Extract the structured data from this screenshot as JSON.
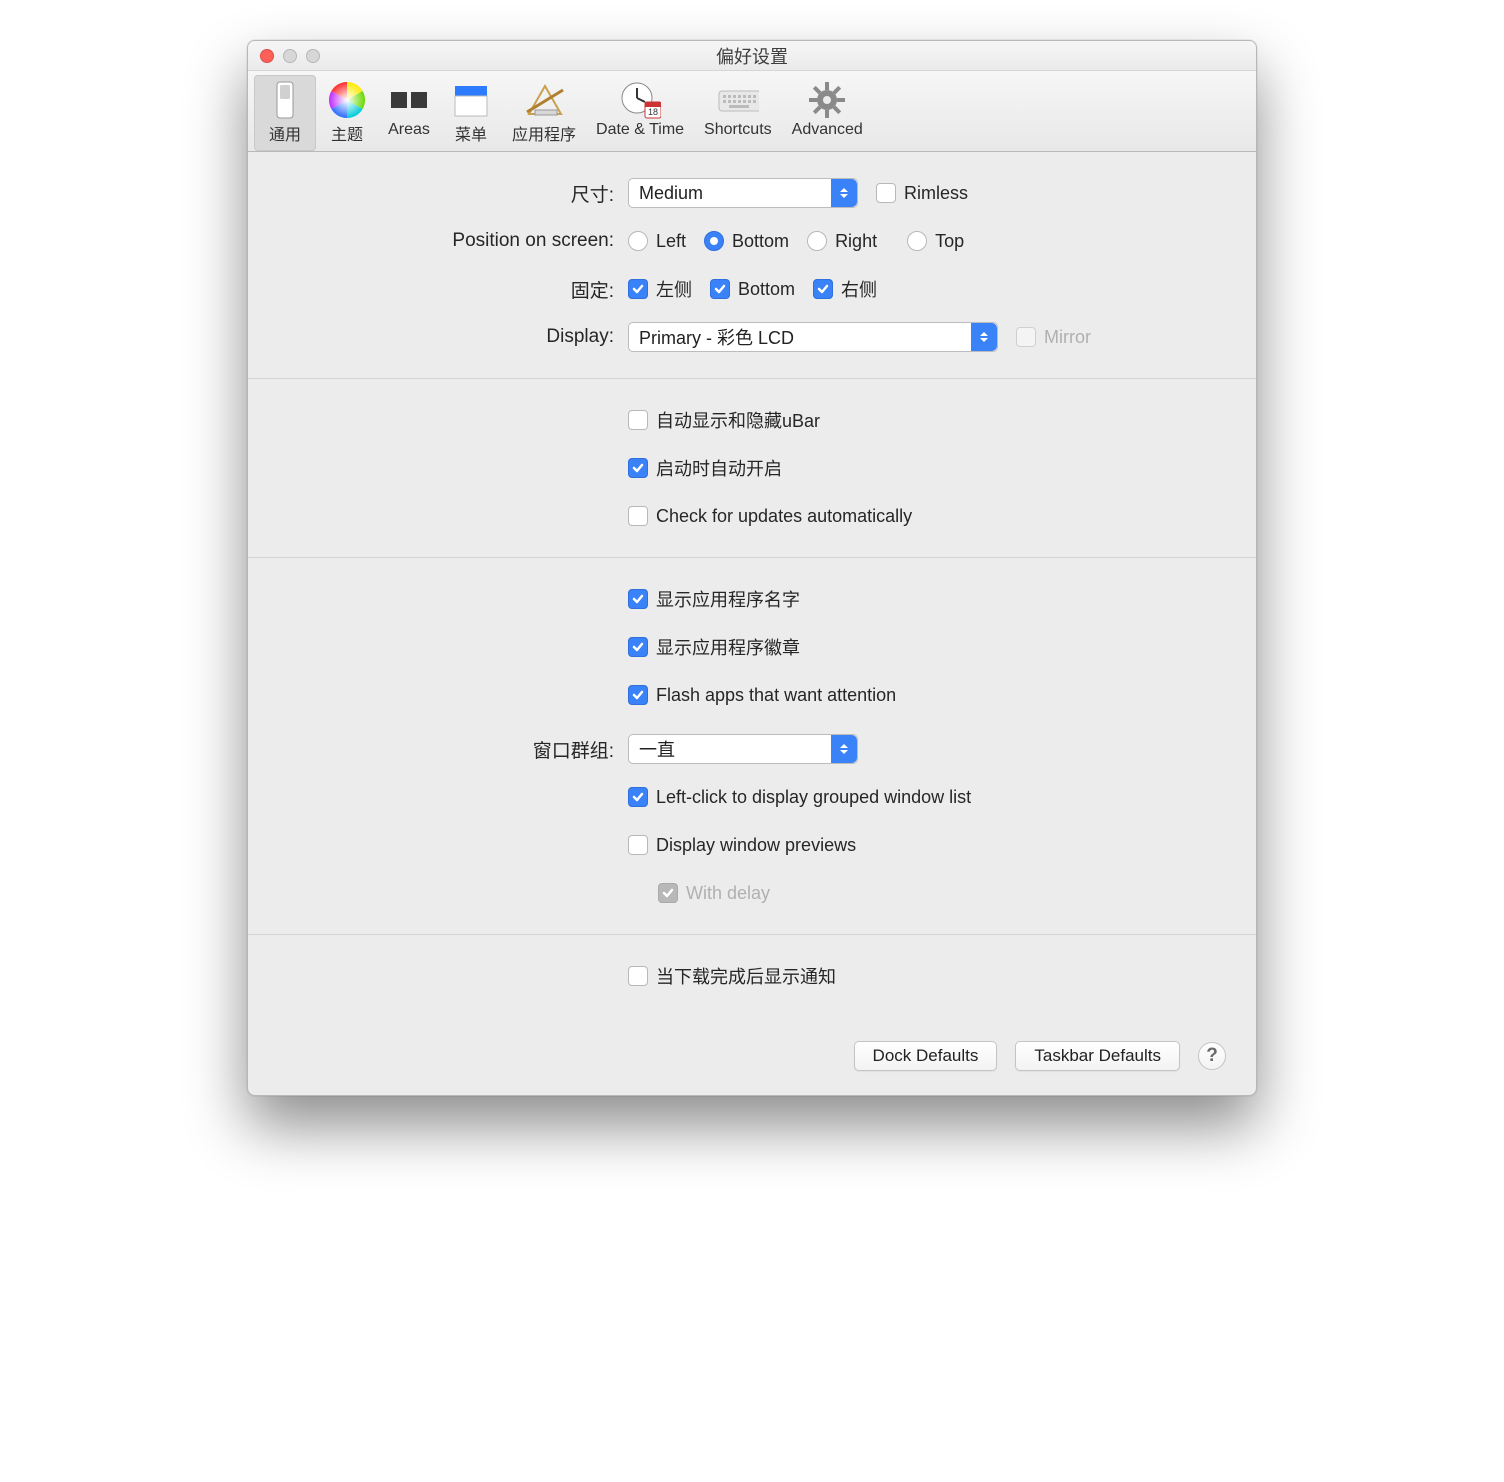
{
  "window": {
    "title": "偏好设置"
  },
  "toolbar": [
    {
      "label": "通用",
      "icon": "switch",
      "selected": true
    },
    {
      "label": "主题",
      "icon": "colorwheel"
    },
    {
      "label": "Areas",
      "icon": "areas"
    },
    {
      "label": "菜单",
      "icon": "menu"
    },
    {
      "label": "应用程序",
      "icon": "apps"
    },
    {
      "label": "Date & Time",
      "icon": "clock"
    },
    {
      "label": "Shortcuts",
      "icon": "keyboard"
    },
    {
      "label": "Advanced",
      "icon": "gear"
    }
  ],
  "labels": {
    "size": "尺寸:",
    "position": "Position on screen:",
    "pinning": "固定:",
    "display": "Display:",
    "window_groups": "窗口群组:"
  },
  "size": {
    "value": "Medium",
    "rimless": "Rimless",
    "rimless_checked": false
  },
  "position": {
    "options": {
      "left": "Left",
      "bottom": "Bottom",
      "right": "Right",
      "top": "Top"
    },
    "selected": "bottom"
  },
  "pinning": {
    "left": {
      "label": "左侧",
      "checked": true
    },
    "bottom": {
      "label": "Bottom",
      "checked": true
    },
    "right": {
      "label": "右侧",
      "checked": true
    }
  },
  "display": {
    "value": "Primary - 彩色 LCD",
    "mirror": "Mirror",
    "mirror_enabled": false,
    "mirror_checked": false
  },
  "section2": {
    "autohide": {
      "label": "自动显示和隐藏uBar",
      "checked": false
    },
    "launch": {
      "label": "启动时自动开启",
      "checked": true
    },
    "updates": {
      "label": "Check for updates automatically",
      "checked": false
    }
  },
  "section3": {
    "show_names": {
      "label": "显示应用程序名字",
      "checked": true
    },
    "show_badges": {
      "label": "显示应用程序徽章",
      "checked": true
    },
    "flash": {
      "label": "Flash apps that want attention",
      "checked": true
    }
  },
  "window_groups": {
    "value": "一直"
  },
  "section3b": {
    "left_click": {
      "label": "Left-click to display grouped window list",
      "checked": true
    },
    "previews": {
      "label": "Display window previews",
      "checked": false
    },
    "with_delay": {
      "label": "With delay",
      "checked": true,
      "enabled": false
    }
  },
  "section4": {
    "download_notify": {
      "label": "当下载完成后显示通知",
      "checked": false
    }
  },
  "footer": {
    "dock_defaults": "Dock Defaults",
    "taskbar_defaults": "Taskbar Defaults",
    "help": "?"
  }
}
